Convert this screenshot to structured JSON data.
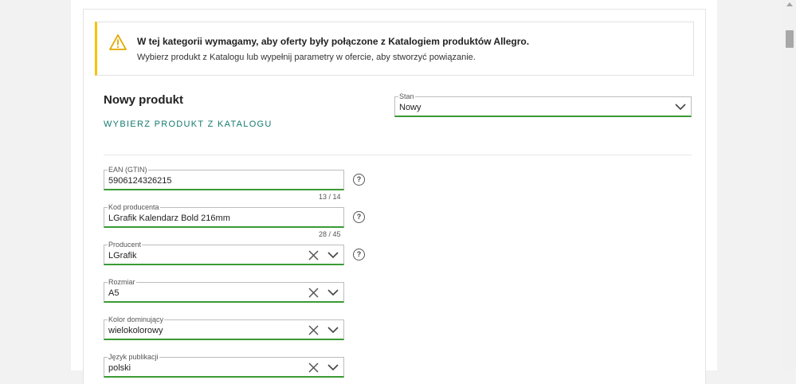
{
  "alert": {
    "title": "W tej kategorii wymagamy, aby oferty były połączone z Katalogiem produktów Allegro.",
    "description": "Wybierz produkt z Katalogu lub wypełnij parametry w ofercie, aby stworzyć powiązanie."
  },
  "product": {
    "heading": "Nowy produkt",
    "catalog_link": "WYBIERZ PRODUKT Z KATALOGU"
  },
  "condition": {
    "label": "Stan",
    "value": "Nowy"
  },
  "fields": {
    "ean": {
      "label": "EAN (GTIN)",
      "value": "5906124326215",
      "counter": "13  /  14"
    },
    "code": {
      "label": "Kod producenta",
      "value": "LGrafik Kalendarz Bold 216mm",
      "counter": "28  /  45"
    },
    "producer": {
      "label": "Producent",
      "value": "LGrafik"
    },
    "size": {
      "label": "Rozmiar",
      "value": "A5"
    },
    "color": {
      "label": "Kolor dominujący",
      "value": "wielokolorowy"
    },
    "language": {
      "label": "Język publikacji",
      "value": "polski"
    }
  },
  "help_glyph": "?",
  "colors": {
    "accent": "#3a9a34",
    "link": "#157a6e",
    "warning": "#f5c400"
  }
}
